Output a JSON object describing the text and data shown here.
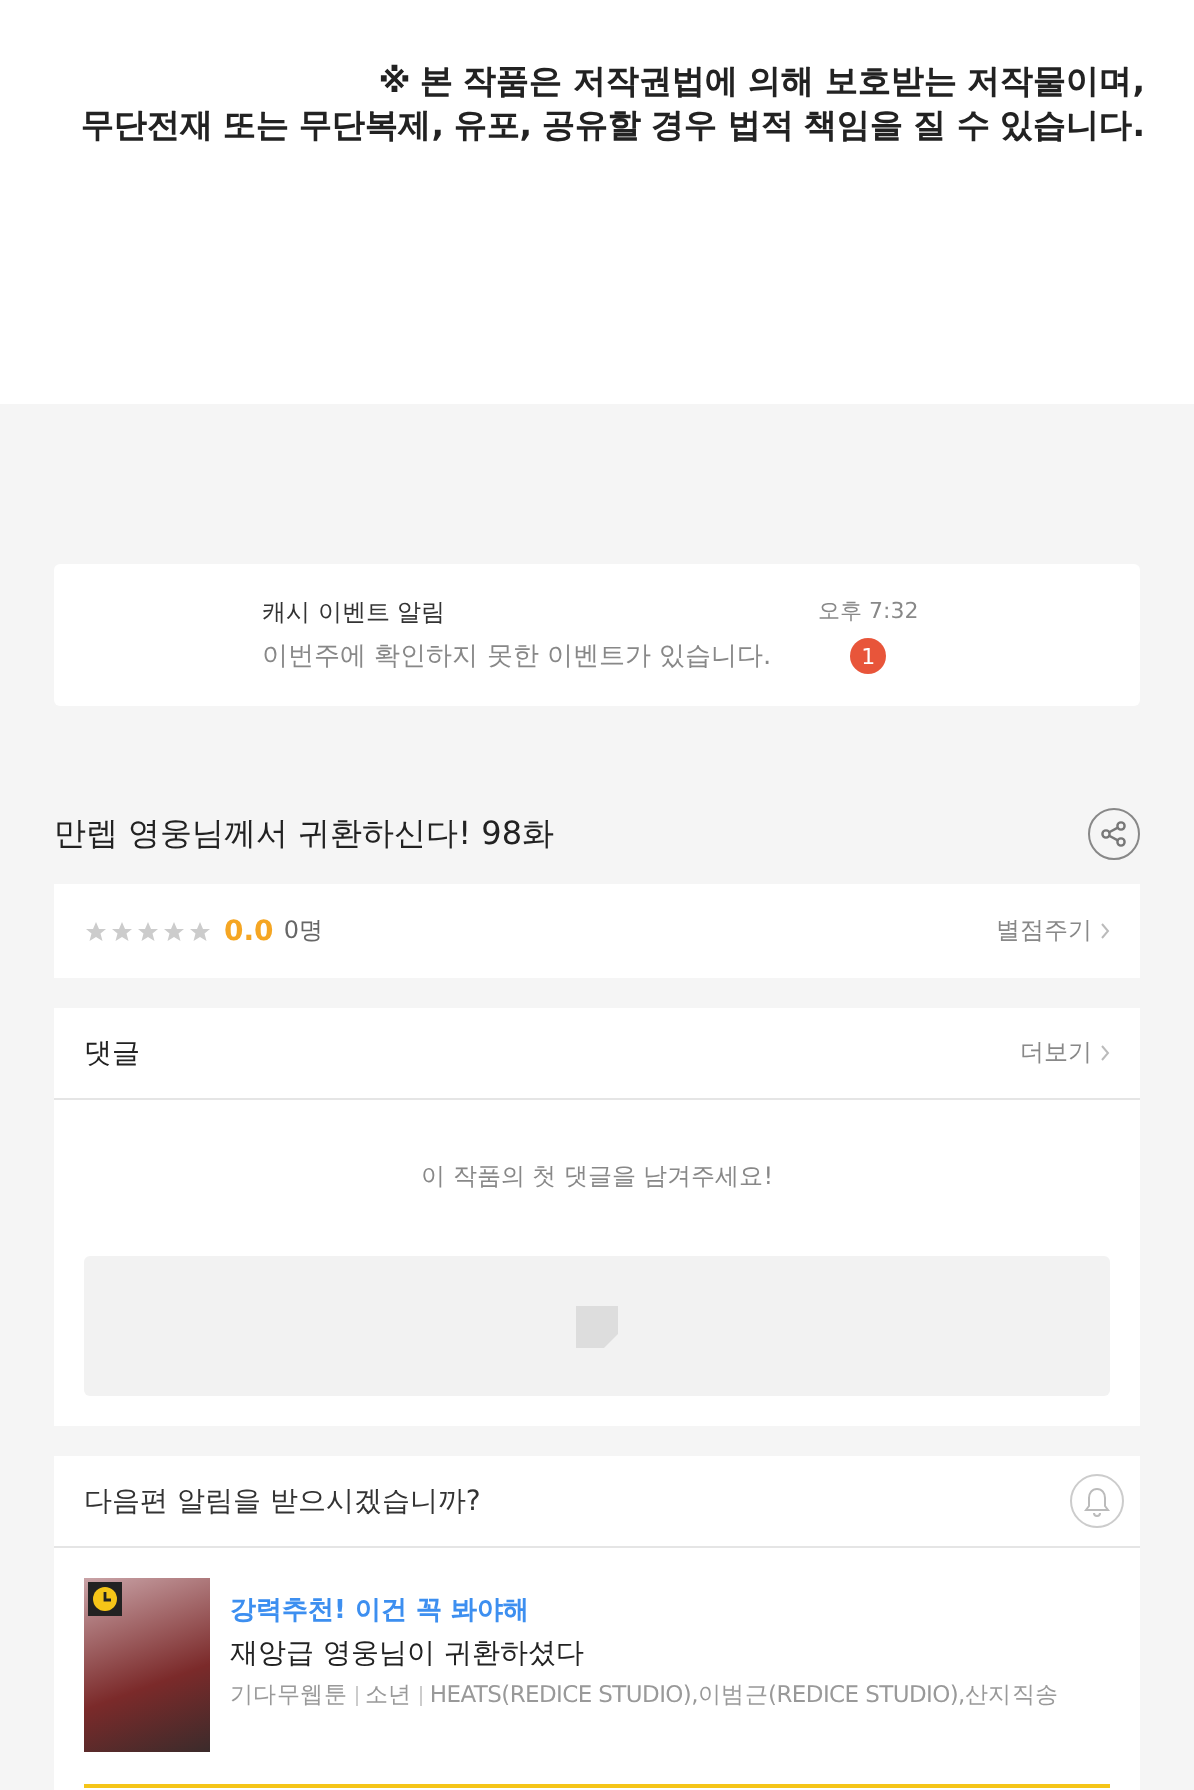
{
  "copyright_notice": {
    "lines": [
      "※ 본 작품은 저작권법에 의해 보호받는 저작물이며,",
      "무단전재 또는 무단복제, 유포, 공유할 경우 법적 책임을 질 수 있습니다."
    ]
  },
  "event_alert": {
    "title": "캐시 이벤트 알림",
    "message": "이번주에 확인하지 못한 이벤트가 있습니다.",
    "time": "오후 7:32",
    "badge": "1"
  },
  "episode": {
    "title": "만렙 영웅님께서 귀환하신다! 98화"
  },
  "rating": {
    "stars": 0,
    "score": "0.0",
    "count": "0명",
    "action": "별점주기"
  },
  "comments": {
    "title": "댓글",
    "more": "더보기",
    "empty_message": "이 작품의 첫 댓글을 남겨주세요!"
  },
  "next_alert": {
    "question": "다음편 알림을 받으시겠습니까?",
    "subscribed": false
  },
  "recommendation": {
    "tagline": "강력추천! 이건 꼭 봐야해",
    "title": "재앙급 영웅님이 귀환하셨다",
    "meta": [
      "기다무웹툰",
      "소년",
      "HEATS(REDICE STUDIO),이범근(REDICE STUDIO),산지직송"
    ]
  }
}
